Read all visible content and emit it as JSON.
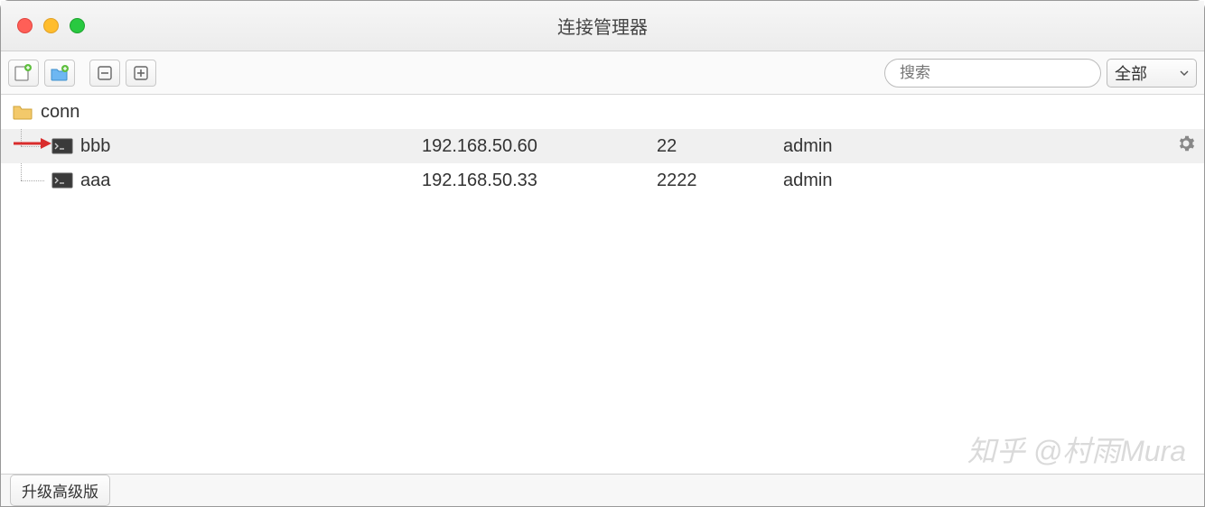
{
  "window": {
    "title": "连接管理器"
  },
  "toolbar": {
    "search_placeholder": "搜索",
    "filter_label": "全部"
  },
  "tree": {
    "folder_name": "conn",
    "items": [
      {
        "name": "bbb",
        "ip": "192.168.50.60",
        "port": "22",
        "user": "admin",
        "selected": true
      },
      {
        "name": "aaa",
        "ip": "192.168.50.33",
        "port": "2222",
        "user": "admin",
        "selected": false
      }
    ]
  },
  "footer": {
    "upgrade_label": "升级高级版"
  },
  "watermark": "知乎 @村雨Mura",
  "colors": {
    "selected_row": "#f0f0f0",
    "arrow": "#d92c2c"
  }
}
